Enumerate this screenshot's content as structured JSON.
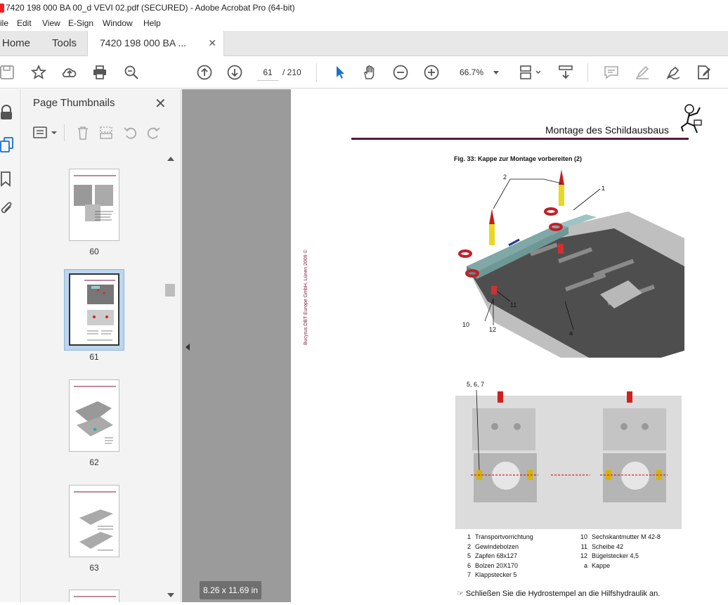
{
  "window": {
    "title": "7420 198 000 BA 00_d VEVI 02.pdf (SECURED) - Adobe Acrobat Pro (64-bit)"
  },
  "menu": [
    "ile",
    "Edit",
    "View",
    "E-Sign",
    "Window",
    "Help"
  ],
  "tabs": {
    "home": "Home",
    "tools": "Tools",
    "document": "7420 198 000 BA ..."
  },
  "toolbar": {
    "current_page": "61",
    "total_pages": "/ 210",
    "zoom": "66.7%"
  },
  "panel": {
    "title": "Page Thumbnails"
  },
  "thumbnails": [
    {
      "label": "60"
    },
    {
      "label": "61",
      "selected": true
    },
    {
      "label": "62"
    },
    {
      "label": "63"
    }
  ],
  "status": {
    "page_size": "8.26 x 11.69 in"
  },
  "document": {
    "header": "Montage des Schildausbaus",
    "figure_caption": "Fig. 33:   Kappe zur Montage vorbereiten (2)",
    "copyright": "Bucyrus DBT Europe GmbH, Lünen 2009 ©",
    "callouts": {
      "c1": "1",
      "c2": "2",
      "c10": "10",
      "c11": "11",
      "c12": "12",
      "ca": "a",
      "c567": "5, 6, 7"
    },
    "legend_left": [
      {
        "n": "1",
        "t": "Transportvorrichtung"
      },
      {
        "n": "2",
        "t": "Gewindebolzen"
      },
      {
        "n": "5",
        "t": "Zapfen 68x127"
      },
      {
        "n": "6",
        "t": "Bolzen 20X170"
      },
      {
        "n": "7",
        "t": "Klappstecker 5"
      }
    ],
    "legend_right": [
      {
        "n": "10",
        "t": "Sechskantmutter M 42-8"
      },
      {
        "n": "11",
        "t": "Scheibe 42"
      },
      {
        "n": "12",
        "t": "Bügelstecker 4,5"
      },
      {
        "n": "a",
        "t": "Kappe"
      }
    ],
    "note": "☞ Schließen Sie die Hydrostempel an die Hilfshydraulik an."
  }
}
